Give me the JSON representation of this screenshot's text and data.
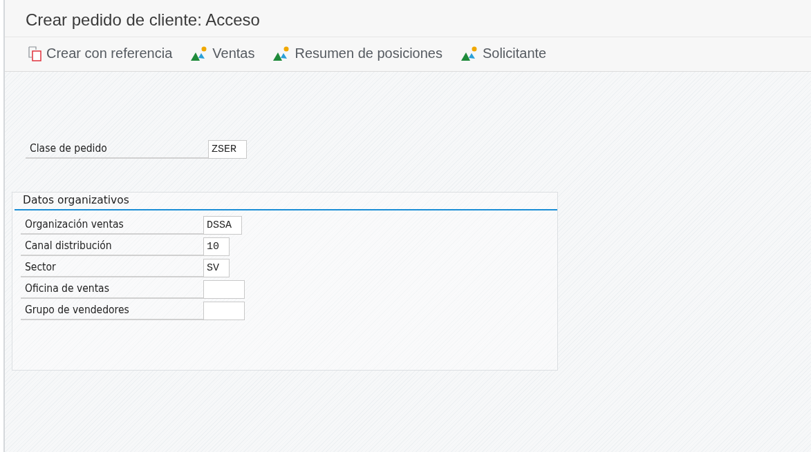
{
  "window": {
    "title": "Crear pedido de cliente: Acceso"
  },
  "toolbar": [
    {
      "label": "Crear con referencia",
      "kind": "copy"
    },
    {
      "label": "Ventas",
      "kind": "mountain"
    },
    {
      "label": "Resumen de posiciones",
      "kind": "mountain"
    },
    {
      "label": "Solicitante",
      "kind": "mountain"
    }
  ],
  "order_type": {
    "label": "Clase de pedido",
    "value": "ZSER"
  },
  "org_data": {
    "title": "Datos organizativos",
    "fields": [
      {
        "label": "Organización ventas",
        "value": "DSSA"
      },
      {
        "label": "Canal distribución",
        "value": "10"
      },
      {
        "label": "Sector",
        "value": "SV"
      },
      {
        "label": "Oficina de ventas"
      },
      {
        "label": "Grupo de vendedores"
      }
    ]
  }
}
